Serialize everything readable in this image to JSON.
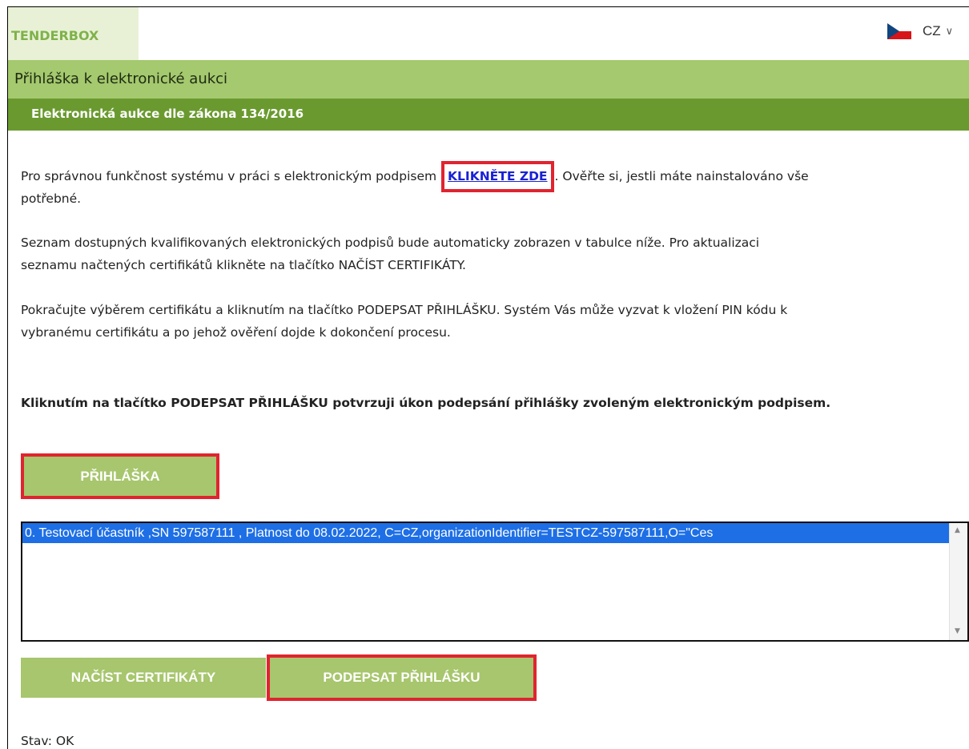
{
  "header": {
    "logo": "TENDERBOX",
    "language": "CZ"
  },
  "title_bar": "Přihláška k elektronické aukci",
  "subtitle_bar": "Elektronická aukce dle zákona 134/2016",
  "paragraphs": {
    "p1_before": "Pro správnou funkčnost systému v práci s elektronickým podpisem ",
    "p1_link": "KLIKNĚTE ZDE",
    "p1_after": ". Ověřte si, jestli máte nainstalováno vše",
    "p1_line2": "potřebné.",
    "p2_line1": "Seznam dostupných kvalifikovaných elektronických podpisů bude automaticky zobrazen v tabulce níže. Pro aktualizaci",
    "p2_line2": "seznamu načtených certifikátů klikněte na tlačítko NAČÍST CERTIFIKÁTY.",
    "p3_line1": "Pokračujte výběrem certifikátu a kliknutím na tlačítko PODEPSAT PŘIHLÁŠKU. Systém Vás může vyzvat k vložení PIN kódu k",
    "p3_line2": "vybranému certifikátu a po jehož ověření dojde k dokončení procesu.",
    "p4": "Kliknutím na tlačítko PODEPSAT PŘIHLÁŠKU potvrzuji úkon podepsání přihlášky zvoleným elektronickým podpisem."
  },
  "buttons": {
    "prihlaska": "PŘIHLÁŠKA",
    "nacist": "NAČÍST CERTIFIKÁTY",
    "podepsat": "PODEPSAT PŘIHLÁŠKU"
  },
  "certificates": [
    "0. Testovací účastník ,SN 597587111 , Platnost do 08.02.2022, C=CZ,organizationIdentifier=TESTCZ-597587111,O=\"Ces"
  ],
  "status": "Stav: OK",
  "colors": {
    "light_green": "#a4c96e",
    "dark_green": "#6a9a2f",
    "highlight_red": "#e0242f",
    "link_blue": "#1a22d4",
    "selection_blue": "#1e6fe6"
  }
}
